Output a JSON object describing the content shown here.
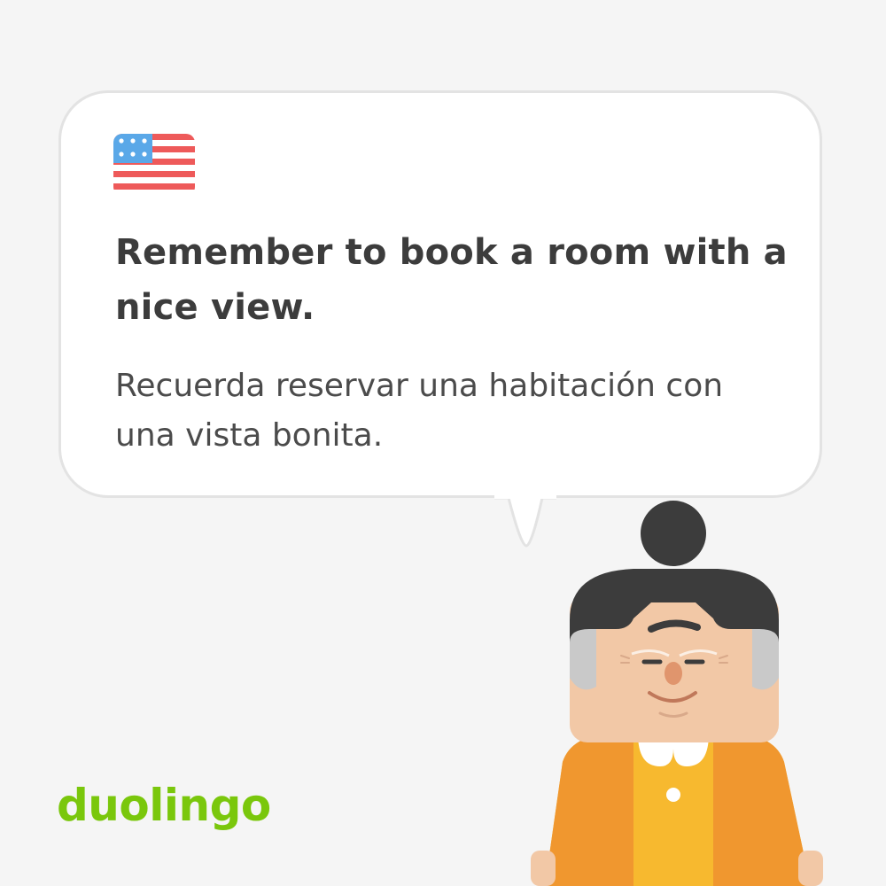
{
  "card": {
    "flag_icon": "us-flag-icon",
    "english_sentence": "Remember to book a room with a nice view.",
    "spanish_sentence": "Recuerda reservar una habitación con una vista bonita."
  },
  "brand": {
    "logo_text": "duolingo",
    "logo_color": "#7ac70c"
  },
  "colors": {
    "background": "#f5f5f5",
    "bubble": "#ffffff",
    "bubble_border": "#e3e3e3",
    "text_primary": "#3c3c3c",
    "text_secondary": "#4b4b4b",
    "flag_blue": "#5aa8e8",
    "flag_red": "#ee5a5a",
    "hair": "#3c3c3c",
    "skin": "#f2c8a6",
    "vest": "#f0972f",
    "shirt": "#f7b92f"
  },
  "character": {
    "icon": "character-illustration"
  }
}
